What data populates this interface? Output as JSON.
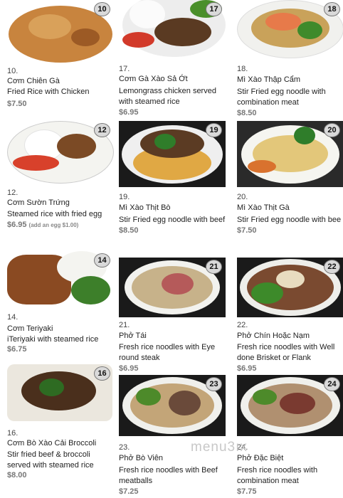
{
  "items": [
    {
      "badge": "10",
      "number": "10.",
      "vn": "Cơm Chiên Gà",
      "desc": "Fried Rice with Chicken",
      "price": "$7.50"
    },
    {
      "badge": "17",
      "number": "17.",
      "vn": "Cơm Gà Xào Sả Ớt",
      "desc": "Lemongrass chicken served with steamed rice",
      "price": "$6.95"
    },
    {
      "badge": "18",
      "number": "18.",
      "vn": "Mì Xào Thập Cẩm",
      "desc": "Stir Fried egg noodle with combination meat",
      "price": "$8.50"
    },
    {
      "badge": "12",
      "number": "12.",
      "vn": "Cơm Sườn Trứng",
      "desc": "Steamed rice with fried egg",
      "price": "$6.95",
      "note": "(add an egg $1.00)"
    },
    {
      "badge": "19",
      "number": "19.",
      "vn": "Mì Xào Thịt Bò",
      "desc": "Stir Fried egg noodle with beef",
      "price": "$8.50"
    },
    {
      "badge": "20",
      "number": "20.",
      "vn": "Mì Xào Thịt Gà",
      "desc": "Stir Fried egg noodle with beef",
      "price": "$7.50"
    },
    {
      "badge": "14",
      "number": "14.",
      "vn": "Cơm Teriyaki",
      "desc": "iTeriyaki with steamed rice",
      "price": "$6.75"
    },
    {
      "badge": "21",
      "number": "21.",
      "vn": "Phở Tái",
      "desc": "Fresh rice noodles with Eye round steak",
      "price": "$6.95"
    },
    {
      "badge": "22",
      "number": "22.",
      "vn": "Phở Chín Hoặc Nạm",
      "desc": "Fresh rice noodles with Well done Brisket or Flank",
      "price": "$6.95"
    },
    {
      "badge": "16",
      "number": "16.",
      "vn": "Cơm Bò Xào Cải Broccoli",
      "desc": "Stir fried beef & broccoli served with steamed rice",
      "price": "$8.00"
    },
    {
      "badge": "23",
      "number": "23.",
      "vn": "Phở Bò Viên",
      "desc": "Fresh rice noodles with Beef meatballs",
      "price": "$7.25"
    },
    {
      "badge": "24",
      "number": "24.",
      "vn": "Phở Đặc Biệt",
      "desc": "Fresh rice noodles with combination meat",
      "price": "$7.75"
    }
  ],
  "watermark": "menu3ıx",
  "colors": {
    "badge_bg": "#d9d9d9",
    "price": "#777777",
    "photo_frame": "#1a1a1a"
  }
}
